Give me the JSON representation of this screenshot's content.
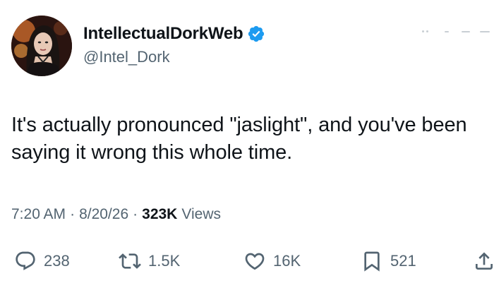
{
  "user": {
    "display_name": "IntellectualDorkWeb",
    "handle": "@Intel_Dork",
    "verified": true,
    "verified_color": "#1d9bf0"
  },
  "tweet": {
    "text": "It's actually pronounced \"jaslight\", and you've been saying it wrong this whole time."
  },
  "meta": {
    "time": "7:20 AM",
    "separator": "·",
    "date": "8/20/26",
    "views_count": "323K",
    "views_label": "Views"
  },
  "actions": {
    "reply": {
      "icon": "reply-icon",
      "count": "238"
    },
    "retweet": {
      "icon": "retweet-icon",
      "count": "1.5K"
    },
    "like": {
      "icon": "heart-icon",
      "count": "16K"
    },
    "bookmark": {
      "icon": "bookmark-icon",
      "count": "521"
    },
    "share": {
      "icon": "share-icon"
    }
  },
  "colors": {
    "text_primary": "#0f1419",
    "text_secondary": "#536471",
    "background": "#ffffff"
  }
}
